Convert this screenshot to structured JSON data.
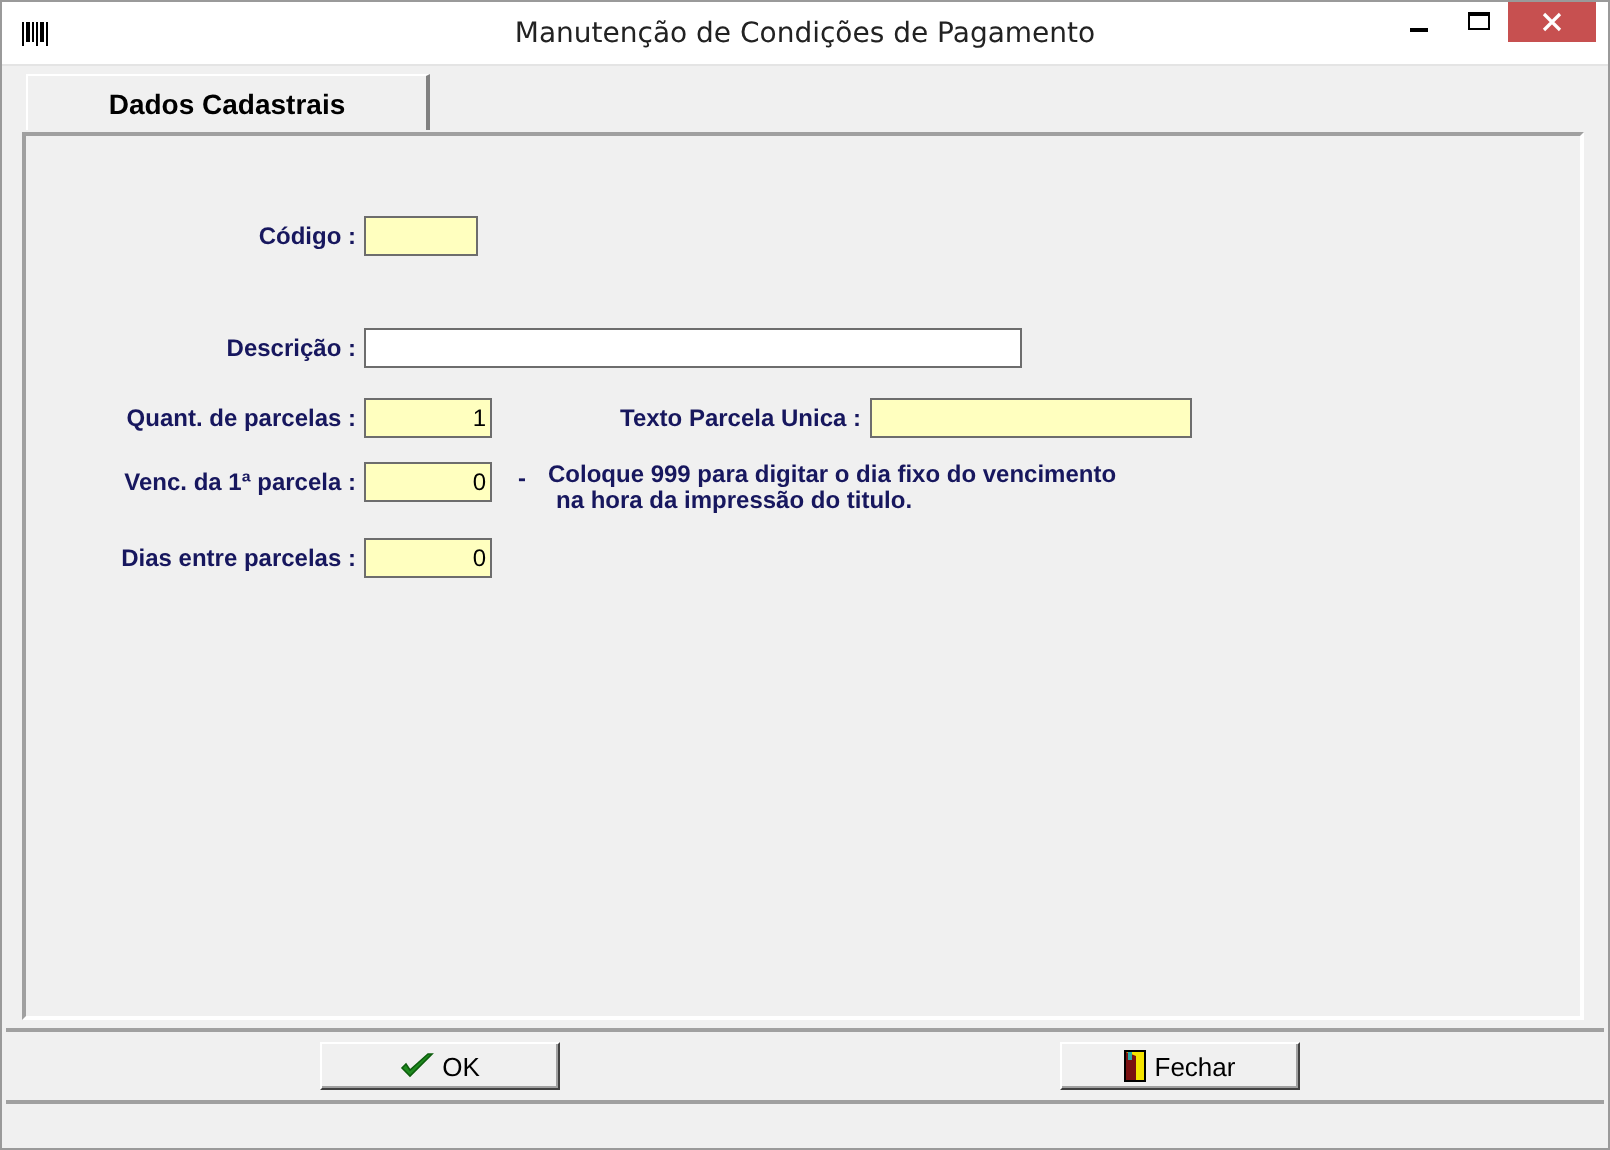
{
  "window": {
    "title": "Manutenção de Condições de Pagamento"
  },
  "tabs": [
    {
      "label": "Dados Cadastrais",
      "selected": true
    }
  ],
  "form": {
    "codigo": {
      "label": "Código :",
      "highlighted": true
    },
    "descricao": {
      "label": "Descrição :",
      "highlighted": false
    },
    "quant_parcelas": {
      "label": "Quant. de parcelas :",
      "value": "1",
      "highlighted": true
    },
    "texto_parcela_unica": {
      "label": "Texto Parcela Unica :",
      "highlighted": true
    },
    "venc_1a_parcela": {
      "label": "Venc. da 1ª parcela :",
      "value": "0",
      "highlighted": true
    },
    "note_dash": "-",
    "note": [
      "Coloque 999 para digitar o dia fixo do vencimento",
      "na hora da impressão do titulo."
    ],
    "dias_entre_parcelas": {
      "label": "Dias entre parcelas :",
      "value": "0",
      "highlighted": true
    }
  },
  "buttons": [
    {
      "label": "OK",
      "kind": "ok"
    },
    {
      "label": "Fechar",
      "kind": "close"
    }
  ]
}
